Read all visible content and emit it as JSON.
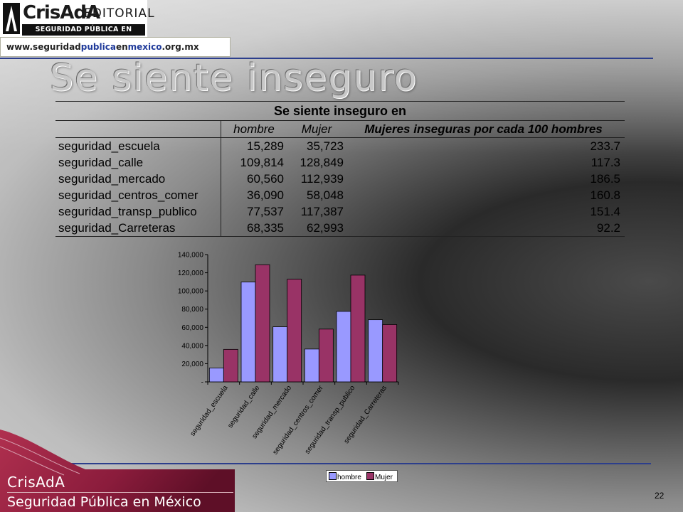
{
  "header": {
    "logo_main": "CrisAdA",
    "logo_editorial": "EDITORIAL",
    "logo_bar": "SEGURIDAD PÚBLICA EN MÉXICO",
    "url_parts": [
      "www.seguridad",
      "publica",
      "en",
      "mexico",
      ".org.mx"
    ]
  },
  "slide": {
    "title": "Se siente inseguro",
    "page_number": "22"
  },
  "table": {
    "title": "Se siente inseguro en",
    "columns": [
      "hombre",
      "Mujer",
      "Mujeres inseguras por cada 100 hombres"
    ],
    "rows": [
      {
        "label": "seguridad_escuela",
        "hombre": "15,289",
        "mujer": "35,723",
        "ratio": "233.7"
      },
      {
        "label": "seguridad_calle",
        "hombre": "109,814",
        "mujer": "128,849",
        "ratio": "117.3"
      },
      {
        "label": "seguridad_mercado",
        "hombre": "60,560",
        "mujer": "112,939",
        "ratio": "186.5"
      },
      {
        "label": "seguridad_centros_comer",
        "hombre": "36,090",
        "mujer": "58,048",
        "ratio": "160.8"
      },
      {
        "label": "seguridad_transp_publico",
        "hombre": "77,537",
        "mujer": "117,387",
        "ratio": "151.4"
      },
      {
        "label": "seguridad_Carreteras",
        "hombre": "68,335",
        "mujer": "62,993",
        "ratio": "92.2"
      }
    ]
  },
  "chart_data": {
    "type": "bar",
    "categories": [
      "seguridad_escuela",
      "seguridad_calle",
      "seguridad_mercado",
      "seguridad_centros_comer",
      "seguridad_transp_publico",
      "seguridad_Carreteras"
    ],
    "series": [
      {
        "name": "hombre",
        "color": "#9999ff",
        "values": [
          15289,
          109814,
          60560,
          36090,
          77537,
          68335
        ]
      },
      {
        "name": "Mujer",
        "color": "#993366",
        "values": [
          35723,
          128849,
          112939,
          58048,
          117387,
          62993
        ]
      }
    ],
    "yticks": [
      "-",
      "20,000",
      "40,000",
      "60,000",
      "80,000",
      "100,000",
      "120,000",
      "140,000"
    ],
    "ylim": [
      0,
      140000
    ],
    "legend_position": "bottom",
    "grid": false
  },
  "footer": {
    "brand": "CrisAdA",
    "subtitle": "Seguridad Pública en México"
  },
  "colors": {
    "rule": "#2c3e8c",
    "corner": "#8b1c3c"
  }
}
